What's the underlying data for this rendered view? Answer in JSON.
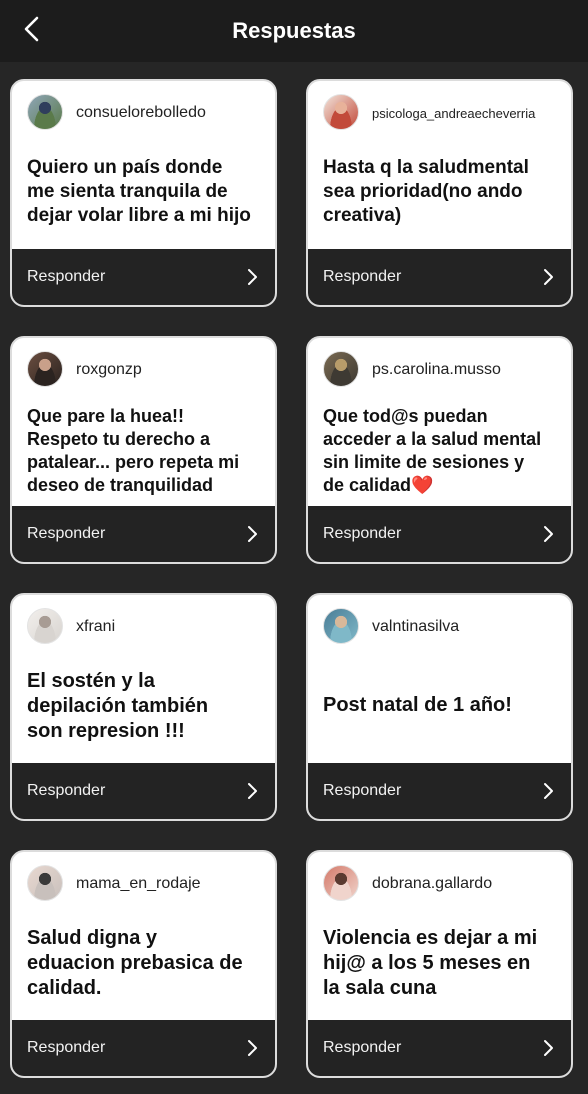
{
  "header": {
    "title": "Respuestas",
    "back_icon": "chevron-left-icon"
  },
  "cards": [
    {
      "username": "consuelorebolledo",
      "text": "Quiero un país donde\nme sienta tranquila de\ndejar volar libre a mi hijo",
      "reply_label": "Responder",
      "avatar_colors": [
        "#5a7a4a",
        "#2f3e5c",
        "#8fa6b8"
      ]
    },
    {
      "username": "psicologa_andreaecheverria",
      "text": "Hasta q la saludmental\nsea prioridad(no ando\ncreativa)",
      "reply_label": "Responder",
      "avatar_colors": [
        "#c24a3a",
        "#e8b29a",
        "#f2e4da"
      ]
    },
    {
      "username": "roxgonzp",
      "text": "Que pare la huea!!\nRespeto tu derecho a\npatalear... pero repeta mi\ndeseo de tranquilidad",
      "reply_label": "Responder",
      "avatar_colors": [
        "#2b2320",
        "#c9a08a",
        "#6b4e40"
      ]
    },
    {
      "username": "ps.carolina.musso",
      "text": "Que tod@s puedan\nacceder a la salud mental\nsin limite de sesiones y\nde calidad",
      "text_suffix": "❤️",
      "reply_label": "Responder",
      "avatar_colors": [
        "#3e3a33",
        "#b89c6a",
        "#7a6a52"
      ]
    },
    {
      "username": "xfrani",
      "text": "El sostén y la\ndepilación también\nson represion !!!",
      "reply_label": "Responder",
      "avatar_colors": [
        "#d8d4d0",
        "#a89c94",
        "#f2efec"
      ]
    },
    {
      "username": "valntinasilva",
      "text": "Post natal de 1 año!",
      "reply_label": "Responder",
      "avatar_colors": [
        "#7fb8c8",
        "#d8b89a",
        "#4a7d96"
      ]
    },
    {
      "username": "mama_en_rodaje",
      "text": "Salud digna  y\neduacion prebasica de\ncalidad.",
      "reply_label": "Responder",
      "avatar_colors": [
        "#c8c0bc",
        "#3a3a3a",
        "#e8d8d0"
      ]
    },
    {
      "username": "dobrana.gallardo",
      "text": "Violencia es dejar a mi\nhij@ a los 5 meses en\nla sala cuna",
      "reply_label": "Responder",
      "avatar_colors": [
        "#f0d4cc",
        "#5a3a30",
        "#d47a6a"
      ]
    }
  ],
  "icons": {
    "reply": "chevron-right-icon",
    "avatar": "user-avatar"
  }
}
